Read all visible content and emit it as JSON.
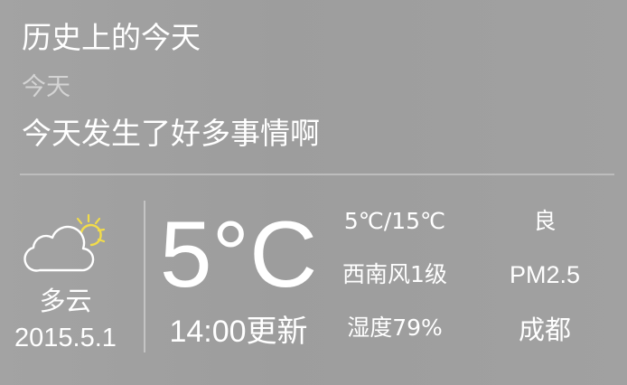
{
  "history": {
    "title": "历史上的今天",
    "date_label": "今天",
    "event": "今天发生了好多事情啊"
  },
  "weather": {
    "icon": "partly-cloudy-icon",
    "condition": "多云",
    "date": "2015.5.1",
    "temperature": "5°C",
    "update_time": "14:00更新",
    "temp_range": "5℃/15℃",
    "wind": "西南风1级",
    "humidity": "湿度79%",
    "air_quality": "良",
    "pm_label": "PM2.5",
    "city": "成都"
  },
  "colors": {
    "background": "#a0a0a0",
    "text": "#ffffff",
    "muted_text": "#d4d4d4",
    "sun": "#f2dc4a"
  }
}
